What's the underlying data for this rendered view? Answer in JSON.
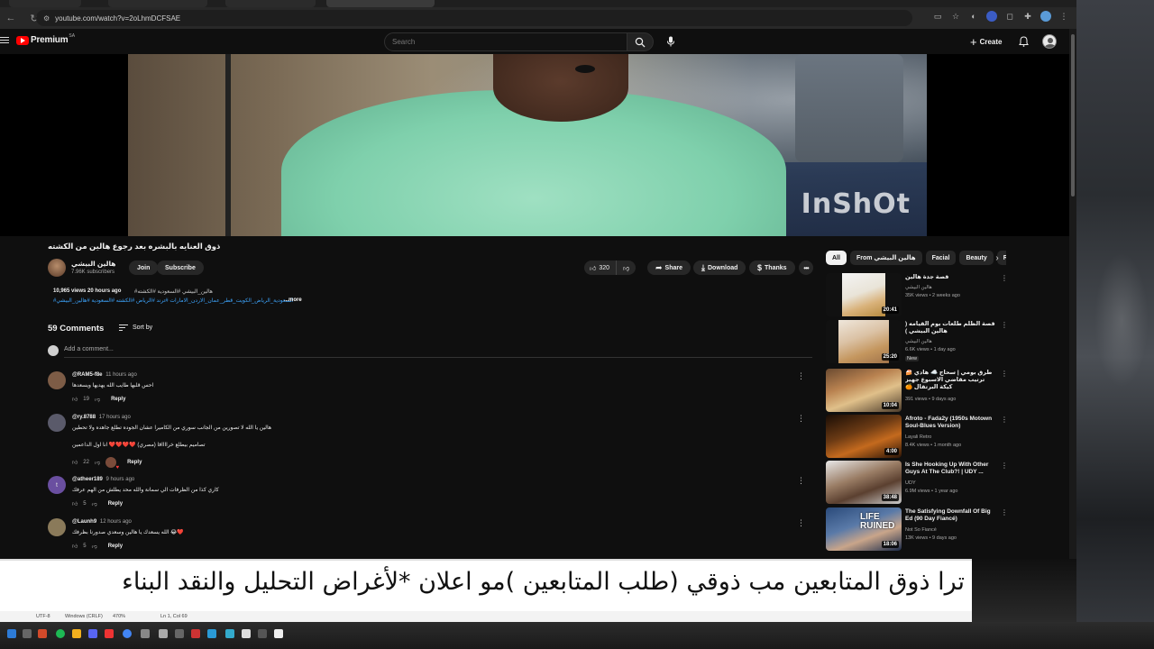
{
  "browser": {
    "url": "youtube.com/watch?v=2oLhmDCFSAE",
    "nav_back": "←",
    "nav_forward": "→",
    "nav_reload": "↻"
  },
  "youtube": {
    "logo_text": "Premium",
    "logo_region": "SA",
    "search_placeholder": "Search",
    "create_label": "Create"
  },
  "video": {
    "watermark": "InShOt",
    "title": "ذوق العنايه بالبشره بعد رجوع هالين من الكشته",
    "channel_name": "هالين البيشي",
    "subscribers": "7.96K subscribers",
    "join_label": "Join",
    "subscribe_label": "Subscribe",
    "like_count": "320",
    "share_label": "Share",
    "download_label": "Download",
    "thanks_label": "Thanks",
    "description": {
      "meta": "10,965 views  20 hours ago",
      "tags_line1": "#هالين_البيشي #السعودية #الكشته",
      "tags_line2": "#السعودية_الرياض_الكويت_قطر_عمان_الاردن_الامارات #ترند #الرياض #الكشته #السعودية #هالين_البيشي",
      "more_label": "...more"
    }
  },
  "comments": {
    "count_label": "59 Comments",
    "sort_label": "Sort by",
    "add_placeholder": "Add a comment...",
    "reply_label": "Reply",
    "items": [
      {
        "author": "@RAM5-f8e",
        "time": "11 hours ago",
        "text": "احس قلبها طايب الله يهديها ويسعدها",
        "likes": "19",
        "avatar_color": "#7d5c46"
      },
      {
        "author": "@ry.8788",
        "time": "17 hours ago",
        "text": "هالين يا الله لا تصورين من الجانب سوري من الكاميرا عشان الجوده تطلع جاهده ولا تحطين",
        "text2": "تصاميم بيطلع خرااااقا (مصري) ❤️❤️❤️❤️ انا اول الداعمين",
        "likes": "22",
        "avatar_color": "#5a5a6a"
      },
      {
        "author": "@atheer189",
        "time": "9 hours ago",
        "text": "كاري كذا من الظرفات الي سمانة والله محد يطلش من الهم عرفك",
        "likes": "5",
        "avatar_color": "#6a4fa0",
        "avatar_letter": "t"
      },
      {
        "author": "@Launh9",
        "time": "12 hours ago",
        "text": "الله يسعدك يا هالين وسعدي صدورنا بظرفك 😂❤️",
        "likes": "5",
        "avatar_color": "#8a7a5a"
      }
    ]
  },
  "recommendations": {
    "chips": [
      "All",
      "From هالين البيشي",
      "Facial",
      "Beauty",
      "Re"
    ],
    "items": [
      {
        "title": "قصة جدة هالين",
        "channel": "هالين البيشي",
        "meta": "35K views • 2 weeks ago",
        "duration": "20:41",
        "thumb": "linear-gradient(160deg,#f4f4f4 0%,#e9e4d8 45%,#d9b27a 70%,#b68a3e 100%)"
      },
      {
        "title": "قصة الظلم طلعات يوم القيامه ( هالين البيشي )",
        "channel": "هالين البيشي",
        "meta": "6.6K views • 1 day ago",
        "new": "New",
        "duration": "25:20",
        "thumb": "linear-gradient(160deg,#efe7dc 0%,#dbc2a5 40%,#c4965e 70%,#a0734a 100%)"
      },
      {
        "title": "طرق بومي | سحاج ☁️ هادي 🍰 ترتيب مقاضي الاسبوع جهيز كيكة البرتقال 🍊",
        "channel": "",
        "meta": "391 views • 9 days ago",
        "duration": "10:04",
        "thumb": "linear-gradient(160deg,#6a4a30 0%,#b98250 35%,#e0c08a 60%,#4a3a2a 100%)"
      },
      {
        "title": "Afroto - Fada2y (1950s Motown Soul-Blues Version)",
        "channel": "Layali Retro",
        "meta": "8.4K views • 1 month ago",
        "duration": "4:00",
        "thumb": "linear-gradient(160deg,#1a0d05 0%,#6b3a14 40%,#c46a1e 65%,#2a1406 100%)"
      },
      {
        "title": "Is She Hooking Up With Other Guys At The Club?! | UDY ...",
        "channel": "UDY",
        "meta": "6.9M views • 1 year ago",
        "duration": "38:48",
        "thumb": "linear-gradient(160deg,#e8e8e8 0%,#9a7d65 40%,#5b4030 65%,#ccc 100%)"
      },
      {
        "title": "The Satisfying Downfall Of Big Ed (90 Day Fiancé)",
        "channel": "Not So Fiancé",
        "meta": "13K views • 9 days ago",
        "duration": "18:06",
        "thumb_overlay": "LIFE RUINED",
        "thumb": "linear-gradient(160deg,#2a4a7a 0%,#5a7aa8 40%,#c9a58a 65%,#1a2a4a 100%)"
      }
    ]
  },
  "overlay": {
    "caption": "ترا ذوق المتابعين مب ذوقي (طلب المتابعين )مو اعلان *لأغراض التحليل والنقد البناء",
    "status_items": [
      "UTF-8",
      "Windows (CRLF)",
      "470%",
      "Ln 1, Col 69"
    ]
  },
  "colors": {
    "background": "#0f0f0f",
    "youtube_red": "#ff0000",
    "link_blue": "#3ea6ff",
    "pill": "#272727"
  }
}
